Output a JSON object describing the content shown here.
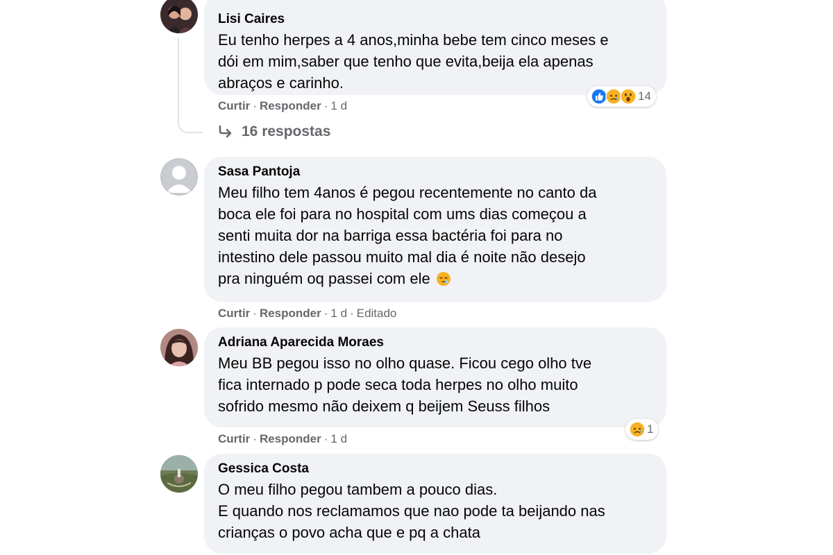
{
  "comments": [
    {
      "author": "Lisi Caires",
      "text": "Eu tenho herpes a 4 anos,minha bebe tem cinco meses e\ndói em mim,saber que tenho que evita,beija ela apenas\nabraços e carinho.",
      "actions": {
        "like": "Curtir",
        "reply": "Responder",
        "time": "1 d"
      },
      "reactions": {
        "icons": [
          "like-icon",
          "sad-icon",
          "wow-icon"
        ],
        "count": "14"
      },
      "replies_label": "16 respostas"
    },
    {
      "author": "Sasa Pantoja",
      "text": "Meu filho tem 4anos é pegou recentemente no canto da\nboca ele foi para no hospital com ums dias começou a\nsenti muita dor na barriga essa bactéria foi para no\nintestino dele passou muito mal dia é noite não desejo\npra ninguém oq passei com ele",
      "actions": {
        "like": "Curtir",
        "reply": "Responder",
        "time": "1 d",
        "edited": "Editado"
      }
    },
    {
      "author": "Adriana Aparecida Moraes",
      "text": "Meu BB pegou isso no olho quase. Ficou cego olho tve\nfica internado p pode seca toda herpes no olho muito\nsofrido mesmo não deixem q beijem Seuss filhos",
      "actions": {
        "like": "Curtir",
        "reply": "Responder",
        "time": "1 d"
      },
      "reactions": {
        "icons": [
          "sad-icon"
        ],
        "count": "1"
      }
    },
    {
      "author": "Gessica Costa",
      "text": "O meu filho pegou tambem a pouco dias.\nE quando nos reclamamos que nao pode ta beijando nas\ncrianças o povo acha que e pq a chata"
    }
  ],
  "colors": {
    "bubble": "#f0f2f5",
    "secondary_text": "#65676b",
    "like_blue": "#1877f2",
    "emoji_yellow": "#f7b125"
  }
}
